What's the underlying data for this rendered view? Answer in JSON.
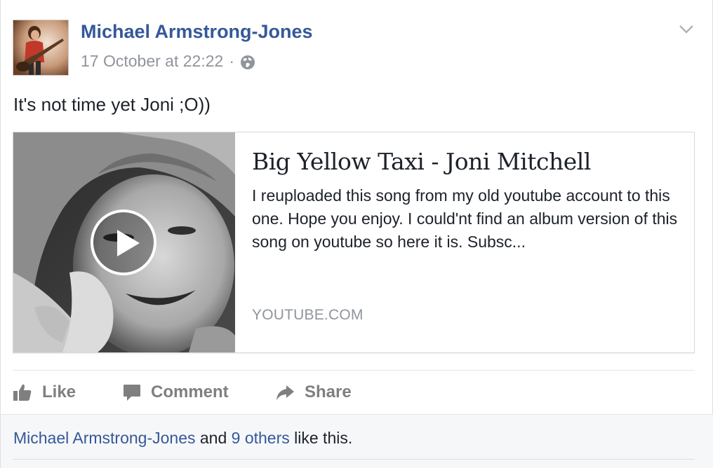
{
  "post": {
    "author": "Michael Armstrong-Jones",
    "timestamp": "17 October at 22:22",
    "separator": "·",
    "privacy_icon": "globe-icon",
    "menu_icon": "chevron-down-icon",
    "text": "It's not time yet Joni ;O))"
  },
  "link": {
    "title": "Big Yellow Taxi - Joni Mitchell",
    "description": "I reuploaded this song from my old youtube account to this one. Hope you enjoy. I could'nt find an album version of this song on youtube so here it is. Subsc...",
    "domain": "YOUTUBE.COM",
    "play_icon": "play-icon"
  },
  "actions": {
    "like_label": "Like",
    "comment_label": "Comment",
    "share_label": "Share"
  },
  "likes": {
    "name": "Michael Armstrong-Jones",
    "and": " and ",
    "others": "9 others",
    "suffix": " like this."
  },
  "colors": {
    "link_blue": "#365899",
    "meta_gray": "#90949c",
    "action_gray": "#7f7f7f",
    "text_dark": "#1d2129"
  }
}
